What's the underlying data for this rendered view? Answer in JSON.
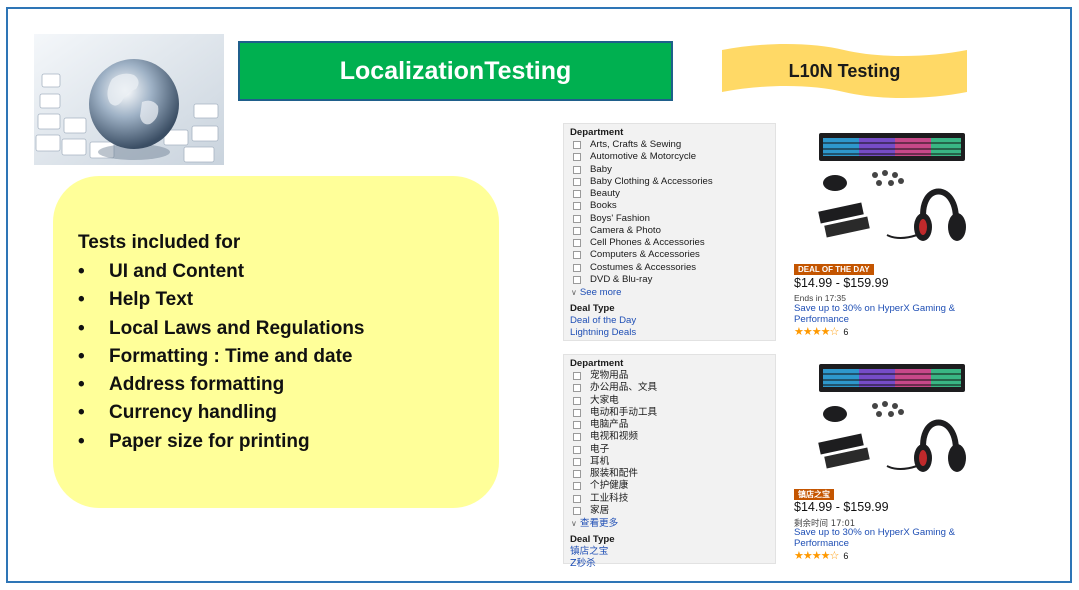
{
  "title": "LocalizationTesting",
  "subtitle": "L10N Testing",
  "colors": {
    "frame_border": "#2e75b6",
    "title_bg": "#00b050",
    "subtitle_bg": "#ffd966",
    "tests_box_bg": "#ffff99",
    "link": "#1f4fb5",
    "deal_badge": "#c45500",
    "stars": "#ff9900"
  },
  "hero_image": {
    "icon": "globe-on-keyboard-image"
  },
  "tests": {
    "heading": "Tests included for",
    "items": [
      "UI and Content",
      "Help Text",
      "Local Laws and Regulations",
      "Formatting : Time and date",
      "Address formatting",
      "Currency handling",
      "Paper size for printing"
    ]
  },
  "english_listing": {
    "department_heading": "Department",
    "departments": [
      "Arts, Crafts & Sewing",
      "Automotive & Motorcycle",
      "Baby",
      "Baby Clothing & Accessories",
      "Beauty",
      "Books",
      "Boys' Fashion",
      "Camera & Photo",
      "Cell Phones & Accessories",
      "Computers & Accessories",
      "Costumes & Accessories",
      "DVD & Blu-ray"
    ],
    "see_more": "See more",
    "deal_type_heading": "Deal Type",
    "deal_links": [
      "Deal of the Day",
      "Lightning Deals"
    ],
    "badge": "DEAL OF THE DAY",
    "price": "$14.99 - $159.99",
    "ends": "Ends in 17:35",
    "save_text": "Save up to 30% on HyperX Gaming & Performance",
    "rating_stars": 4.5,
    "rating_count": "6"
  },
  "chinese_listing": {
    "department_heading": "Department",
    "departments": [
      "宠物用品",
      "办公用品、文具",
      "大家电",
      "电动和手动工具",
      "电脑产品",
      "电视和视频",
      "电子",
      "耳机",
      "服装和配件",
      "个护健康",
      "工业科技",
      "家居"
    ],
    "see_more": "查看更多",
    "deal_type_heading": "Deal Type",
    "deal_links": [
      "镇店之宝",
      "Z秒杀"
    ],
    "badge": "镇店之宝",
    "price": "$14.99 - $159.99",
    "ends": "剩余时间 17:01",
    "save_text": "Save up to 30% on HyperX Gaming & Performance",
    "rating_stars": 4.5,
    "rating_count": "6"
  }
}
